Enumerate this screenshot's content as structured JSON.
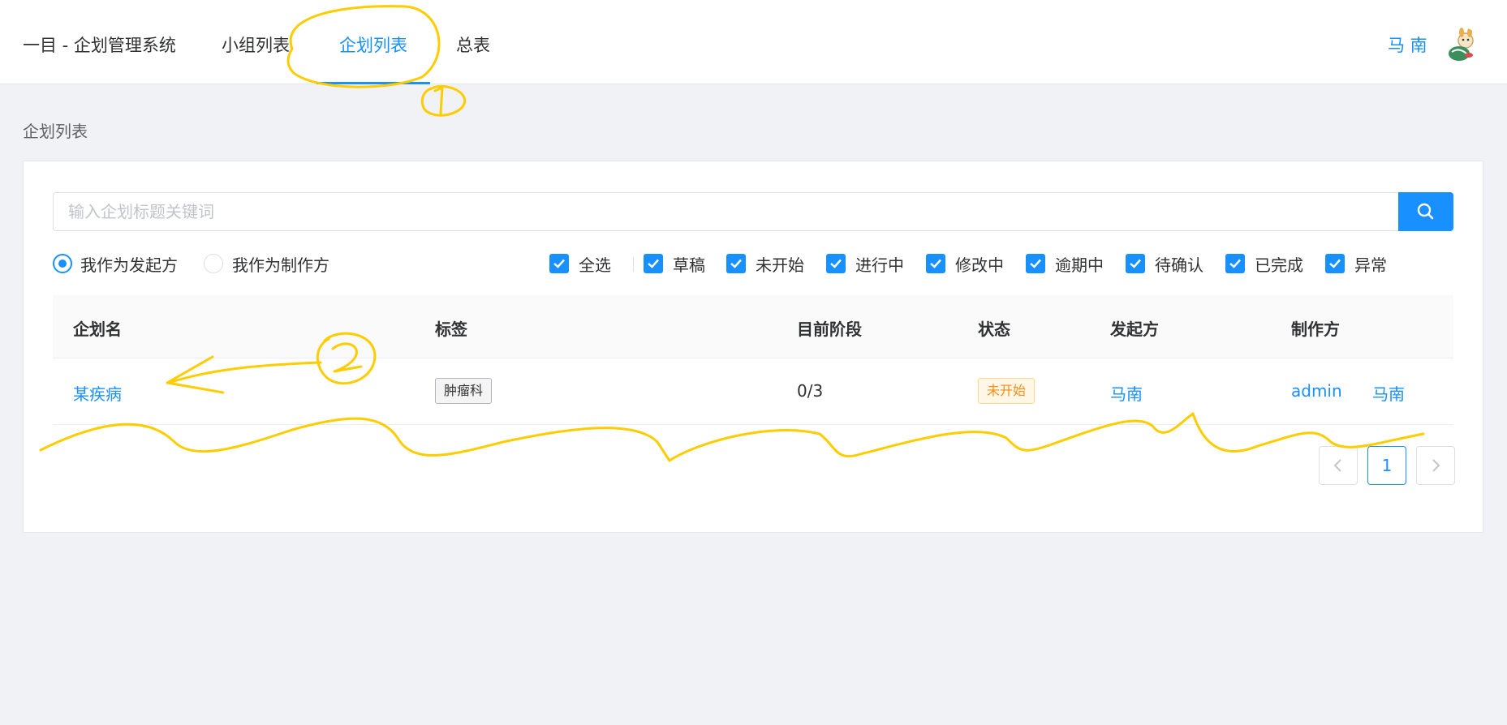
{
  "header": {
    "app_title": "一目 - 企划管理系统",
    "tabs": [
      {
        "label": "小组列表",
        "active": false
      },
      {
        "label": "企划列表",
        "active": true
      },
      {
        "label": "总表",
        "active": false
      }
    ],
    "user_name": "马 南",
    "accent_color": "#1890ff"
  },
  "breadcrumb": "企划列表",
  "search": {
    "placeholder": "输入企划标题关键词",
    "value": "",
    "button_icon": "search-icon"
  },
  "filters": {
    "role_options": [
      {
        "label": "我作为发起方",
        "checked": true
      },
      {
        "label": "我作为制作方",
        "checked": false
      }
    ],
    "status_options": [
      {
        "label": "全选",
        "checked": true
      },
      {
        "label": "草稿",
        "checked": true
      },
      {
        "label": "未开始",
        "checked": true
      },
      {
        "label": "进行中",
        "checked": true
      },
      {
        "label": "修改中",
        "checked": true
      },
      {
        "label": "逾期中",
        "checked": true
      },
      {
        "label": "待确认",
        "checked": true
      },
      {
        "label": "已完成",
        "checked": true
      },
      {
        "label": "异常",
        "checked": true
      }
    ]
  },
  "table": {
    "columns": [
      "企划名",
      "标签",
      "目前阶段",
      "状态",
      "发起方",
      "制作方"
    ],
    "rows": [
      {
        "name": "某疾病",
        "tag": "肿瘤科",
        "stage": "0/3",
        "status": "未开始",
        "initiator": "马南",
        "producers": [
          "admin",
          "马南"
        ]
      }
    ]
  },
  "pagination": {
    "current_page": "1",
    "prev_icon": "chevron-left-icon",
    "next_icon": "chevron-right-icon"
  },
  "annotations": {
    "color": "#ffcc00",
    "marks": [
      "①",
      "②"
    ]
  }
}
